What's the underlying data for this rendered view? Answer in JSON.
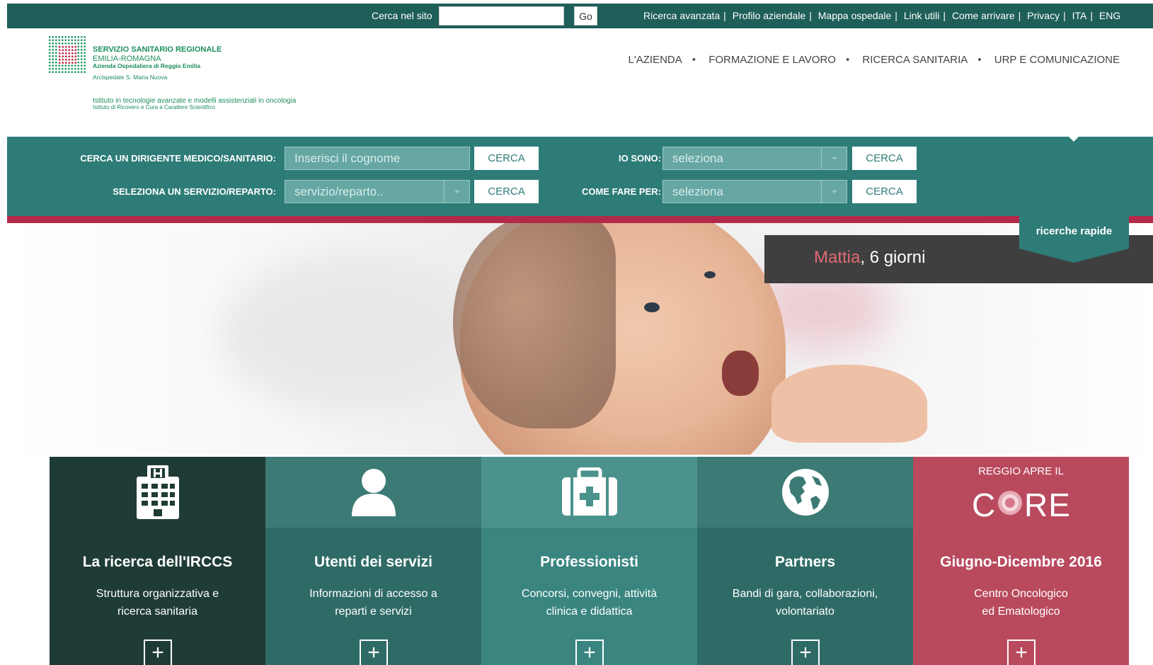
{
  "topbar": {
    "search_label": "Cerca nel sito",
    "search_value": "",
    "go_label": "Go",
    "links": [
      "Ricerca avanzata",
      "Profilo aziendale",
      "Mappa ospedale",
      "Link utili",
      "Come arrivare",
      "Privacy",
      "ITA",
      "ENG"
    ],
    "bg_color": "#1f5f5a"
  },
  "logo": {
    "line1": "SERVIZIO SANITARIO REGIONALE",
    "line2": "EMILIA-ROMAGNA",
    "line3": "Azienda Ospedaliera di Reggio Emilia",
    "line4": "Arcispedale S. Maria Nuova",
    "sub1": "Istituto in tecnologie avanzate e modelli assistenziali in oncologia",
    "sub2": "Istituto di Ricovero e Cura a Carattere Scientifico",
    "color": "#1c8e5c"
  },
  "mainnav": [
    "L'AZIENDA",
    "FORMAZIONE E LAVORO",
    "RICERCA SANITARIA",
    "URP E COMUNICAZIONE"
  ],
  "quick_search": {
    "bg_color": "#2e7c78",
    "dirigente_label": "CERCA UN DIRIGENTE MEDICO/SANITARIO:",
    "dirigente_placeholder": "Inserisci il cognome",
    "servizio_label": "SELEZIONA UN SERVIZIO/REPARTO:",
    "servizio_value": "servizio/reparto..",
    "iosono_label": "IO SONO:",
    "iosono_value": "seleziona",
    "comefare_label": "COME FARE PER:",
    "comefare_value": "seleziona",
    "button_label": "CERCA",
    "rapid_label": "ricerche rapide"
  },
  "hero": {
    "caption_name": "Mattia",
    "caption_rest": ", 6 giorni",
    "accent_red": "#b3294a"
  },
  "tiles": [
    {
      "icon": "hospital-icon",
      "title": "La ricerca dell'IRCCS",
      "desc1": "Struttura organizzativa e",
      "desc2": "ricerca sanitaria",
      "color": "#1f3b35"
    },
    {
      "icon": "user-icon",
      "title": "Utenti dei servizi",
      "desc1": "Informazioni di accesso a",
      "desc2": "reparti e servizi",
      "color": "#2f6b66"
    },
    {
      "icon": "first-aid-kit-icon",
      "title": "Professionisti",
      "desc1": "Concorsi, convegni, attività",
      "desc2": "clinica e didattica",
      "color": "#3a8580"
    },
    {
      "icon": "globe-icon",
      "title": "Partners",
      "desc1": "Bandi di gara, collaborazioni,",
      "desc2": "volontariato",
      "color": "#2f6b66"
    },
    {
      "icon": "core-logo",
      "top_text": "REGGIO APRE IL",
      "logo_text": "CORE",
      "title": "Giugno-Dicembre 2016",
      "desc1": "Centro Oncologico",
      "desc2": "ed Ematologico",
      "color": "#b94a5e"
    }
  ],
  "tile_plus": "+"
}
